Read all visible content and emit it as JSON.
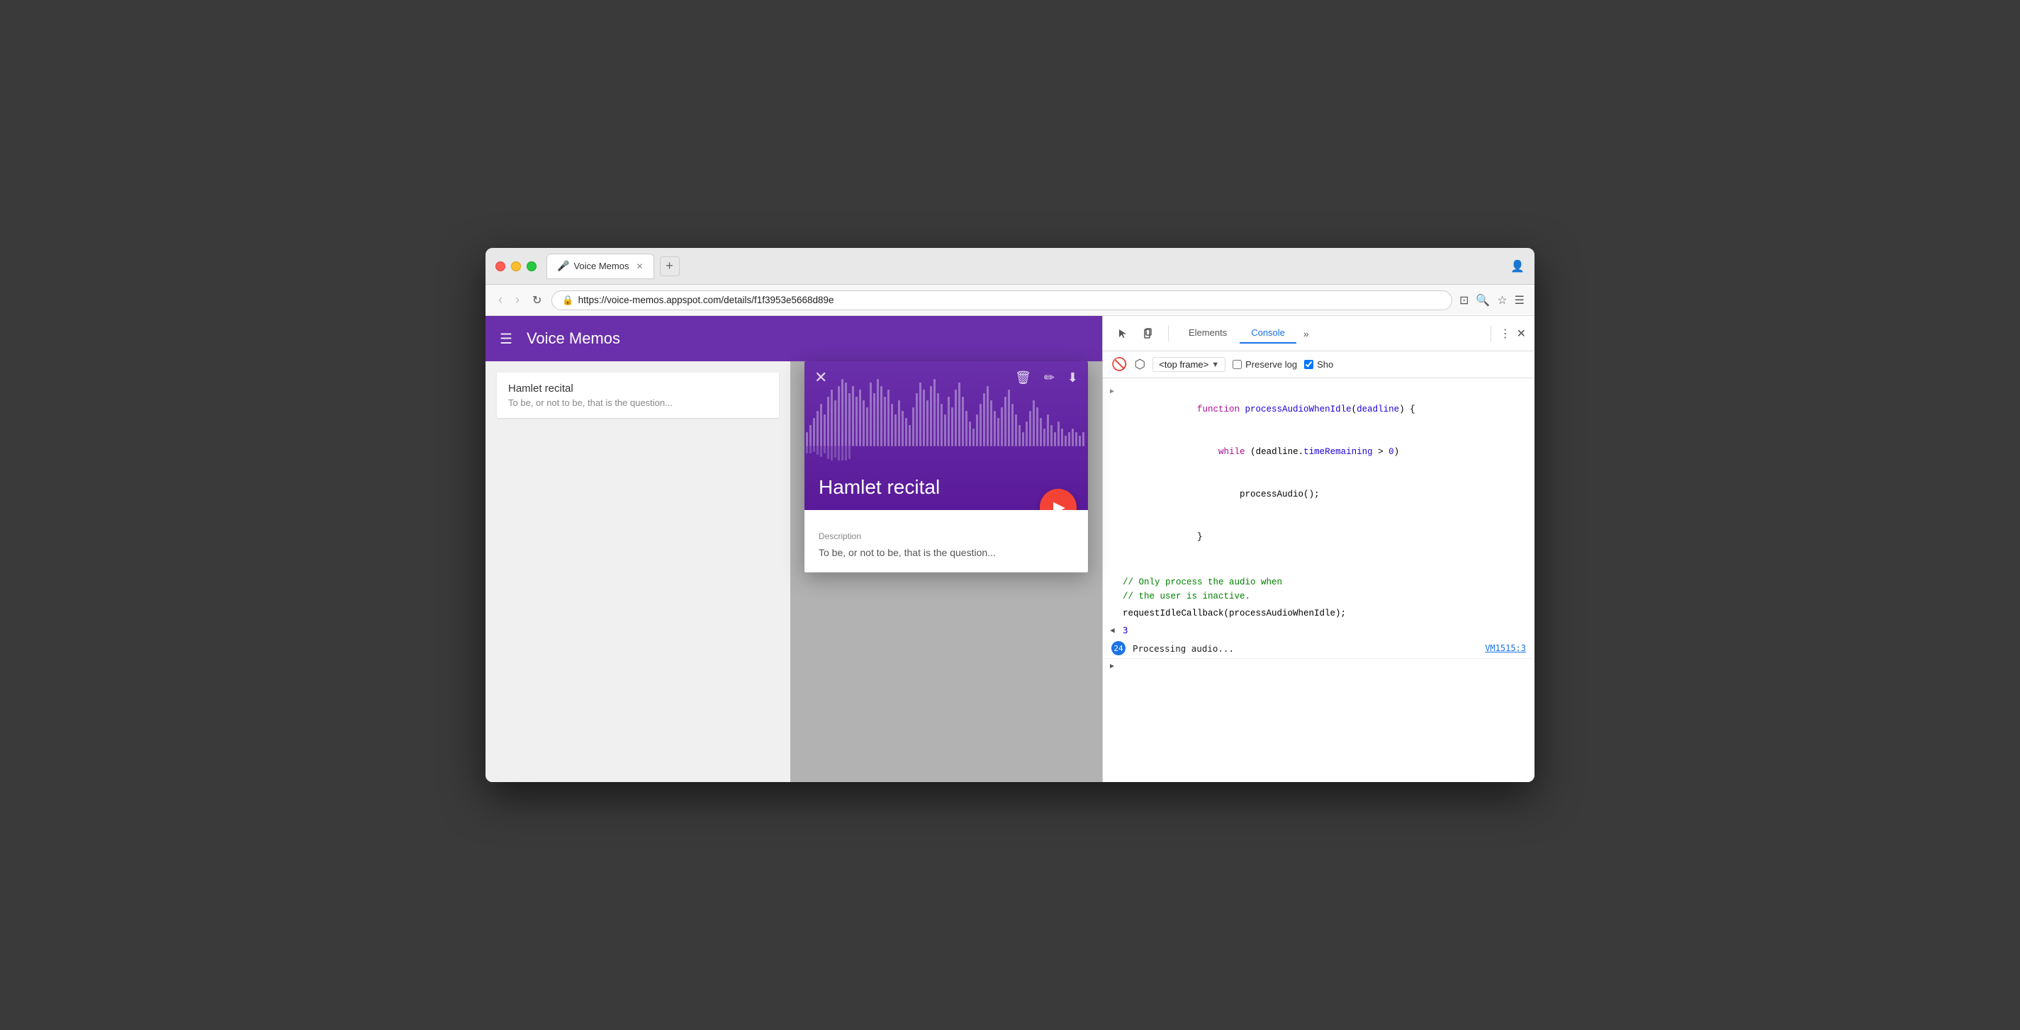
{
  "browser": {
    "traffic_lights": {
      "close_label": "close",
      "minimize_label": "minimize",
      "maximize_label": "maximize"
    },
    "tab": {
      "title": "Voice Memos",
      "icon": "🎤",
      "close_symbol": "✕"
    },
    "new_tab_symbol": "+",
    "window_controls": {
      "resize_symbol": "⊡",
      "search_symbol": "🔍",
      "star_symbol": "☆",
      "menu_symbol": "☰",
      "profile_symbol": "👤"
    },
    "nav": {
      "back_symbol": "‹",
      "forward_symbol": "›",
      "reload_symbol": "↻"
    },
    "url": "https://voice-memos.appspot.com/details/f1f3953e5668d89e",
    "secure_icon": "🔒"
  },
  "app": {
    "header": {
      "hamburger_symbol": "☰",
      "title": "Voice Memos"
    },
    "memo_list": {
      "items": [
        {
          "title": "Hamlet recital",
          "description": "To be, or not to be, that is the question..."
        }
      ]
    },
    "modal": {
      "title": "Hamlet recital",
      "close_symbol": "✕",
      "delete_symbol": "🗑",
      "edit_symbol": "✏",
      "download_symbol": "⬇",
      "play_symbol": "▶",
      "description_label": "Description",
      "description_text": "To be, or not to be, that is the question..."
    }
  },
  "devtools": {
    "tabs": [
      {
        "label": "Elements",
        "active": false
      },
      {
        "label": "Console",
        "active": true
      }
    ],
    "more_symbol": "»",
    "kebab_symbol": "⋮",
    "close_symbol": "✕",
    "cursor_tool_symbol": "↖",
    "device_tool_symbol": "□",
    "console_toolbar": {
      "clear_symbol": "🚫",
      "filter_symbol": "⬡",
      "frame_label": "<top frame>",
      "dropdown_symbol": "▼",
      "preserve_log_label": "Preserve log",
      "preserve_log_checked": false,
      "show_label": "Sho"
    },
    "console_output": {
      "block1": {
        "expand_arrow": "▶",
        "lines": [
          {
            "content": "function processAudioWhenIdle(deadline) {",
            "parts": [
              {
                "type": "keyword",
                "text": "function "
              },
              {
                "type": "fnname",
                "text": "processAudioWhenIdle"
              },
              {
                "type": "plain",
                "text": "("
              },
              {
                "type": "param",
                "text": "deadline"
              },
              {
                "type": "plain",
                "text": ") {"
              }
            ]
          },
          {
            "content": "    while (deadline.timeRemaining > 0)",
            "parts": [
              {
                "type": "indent",
                "text": "    "
              },
              {
                "type": "keyword",
                "text": "while"
              },
              {
                "type": "plain",
                "text": " (deadline."
              },
              {
                "type": "prop",
                "text": "timeRemaining"
              },
              {
                "type": "plain",
                "text": " > "
              },
              {
                "type": "num",
                "text": "0"
              },
              {
                "type": "plain",
                "text": ")"
              }
            ]
          },
          {
            "content": "        processAudio();",
            "parts": [
              {
                "type": "indent",
                "text": "        "
              },
              {
                "type": "plain",
                "text": "processAudio();"
              }
            ]
          },
          {
            "content": "}",
            "parts": [
              {
                "type": "plain",
                "text": "}"
              }
            ]
          }
        ]
      },
      "spacer": true,
      "comment_lines": [
        "// Only process the audio when",
        "// the user is inactive."
      ],
      "callback_line": "requestIdleCallback(processAudioWhenIdle);",
      "result": {
        "arrow": "◀",
        "value": "3"
      },
      "log_entry": {
        "count": "24",
        "message": "Processing audio...",
        "source": "VM1515:3"
      },
      "prompt_arrow": "▶"
    }
  }
}
